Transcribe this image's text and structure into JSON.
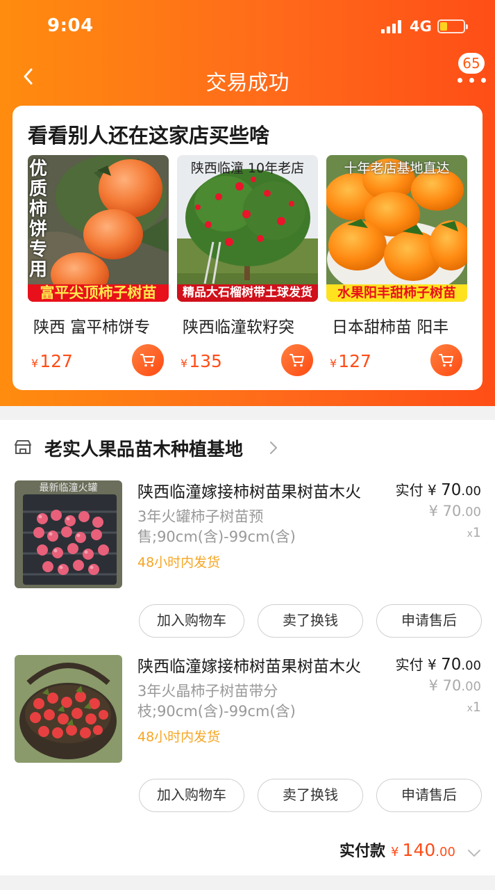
{
  "status_bar": {
    "time": "9:04",
    "network": "4G"
  },
  "nav": {
    "title": "交易成功",
    "badge_count": "65"
  },
  "recommend": {
    "title": "看看别人还在这家店买些啥",
    "items": [
      {
        "name": "陕西 富平柿饼专",
        "price_currency": "¥",
        "price": "127",
        "img_side_text": "优质柿饼专用",
        "img_banner": "富平尖顶柿子树苗"
      },
      {
        "name": "陕西临潼软籽突",
        "price_currency": "¥",
        "price": "135",
        "img_top_text": "陕西临潼  10年老店",
        "img_banner": "精品大石榴树带土球发货"
      },
      {
        "name": "日本甜柿苗 阳丰",
        "price_currency": "¥",
        "price": "127",
        "img_top_text": "十年老店基地直达",
        "img_banner": "水果阳丰甜柿子树苗"
      }
    ]
  },
  "order": {
    "shop_name": "老实人果品苗木种植基地",
    "items": [
      {
        "title": "陕西临潼嫁接柿树苗果树苗木火",
        "spec": "3年火罐柿子树苗预售;90cm(含)-99cm(含)",
        "shipping": "48小时内发货",
        "paid_label": "实付",
        "currency": "¥",
        "paid_int": "70",
        "paid_dec": ".00",
        "orig_int": "70",
        "orig_dec": ".00",
        "qty_prefix": "x",
        "qty": "1",
        "thumb_text": "最新临潼火罐",
        "buttons": [
          "加入购物车",
          "卖了换钱",
          "申请售后"
        ]
      },
      {
        "title": "陕西临潼嫁接柿树苗果树苗木火",
        "spec": "3年火晶柿子树苗带分枝;90cm(含)-99cm(含)",
        "shipping": "48小时内发货",
        "paid_label": "实付",
        "currency": "¥",
        "paid_int": "70",
        "paid_dec": ".00",
        "orig_int": "70",
        "orig_dec": ".00",
        "qty_prefix": "x",
        "qty": "1",
        "buttons": [
          "加入购物车",
          "卖了换钱",
          "申请售后"
        ]
      }
    ],
    "total": {
      "label": "实付款",
      "currency": "¥",
      "amount_int": "140",
      "amount_dec": ".00"
    }
  },
  "colors": {
    "header_gradient_start": "#ff8c0f",
    "header_gradient_end": "#ff4e17",
    "price_accent": "#ff4d18",
    "shipping_text": "#f5a623",
    "banner_red": "#e8101a",
    "banner_yellow": "#ffe94d"
  },
  "icons": [
    "signal-icon",
    "battery-icon",
    "back-chevron-icon",
    "more-dots-icon",
    "cart-icon",
    "shop-icon",
    "chevron-right-icon",
    "chevron-down-icon"
  ]
}
